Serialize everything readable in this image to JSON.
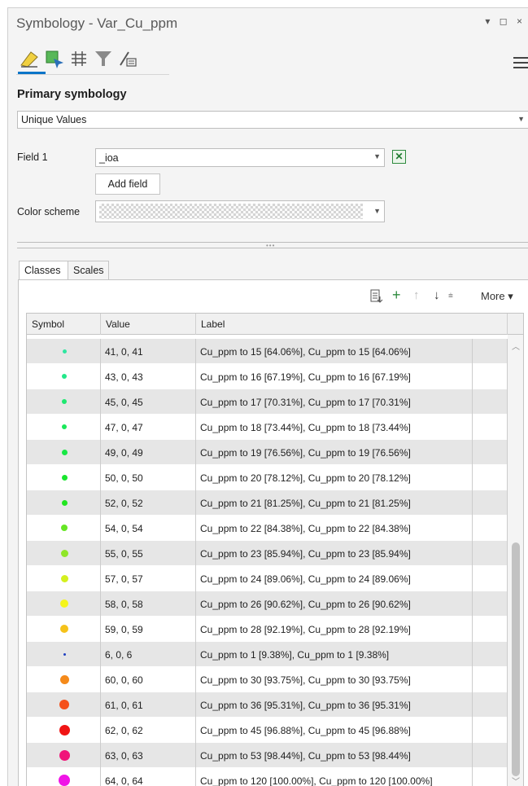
{
  "window": {
    "title": "Symbology - Var_Cu_ppm",
    "controls": "▾ ◻ ×"
  },
  "toolbar": {
    "icons": [
      "primary-symbology-icon",
      "vary-symbology-icon",
      "symbol-layers-icon",
      "filter-icon",
      "display-options-icon"
    ],
    "active_index": 0
  },
  "primary": {
    "section_title": "Primary symbology",
    "method": "Unique Values"
  },
  "form": {
    "field1_label": "Field 1",
    "field1_value": "_ioa",
    "add_field_label": "Add field",
    "color_scheme_label": "Color scheme"
  },
  "tabs": [
    {
      "label": "Classes",
      "active": true
    },
    {
      "label": "Scales",
      "active": false
    }
  ],
  "class_tools": {
    "more_label": "More ▾"
  },
  "grid": {
    "headers": {
      "symbol": "Symbol",
      "value": "Value",
      "label": "Label"
    },
    "rows": [
      {
        "value": "41, 0, 41",
        "label": "Cu_ppm  to 15  [64.06%], Cu_ppm  to 15  [64.06%]",
        "color": "#2ee6a0",
        "size": 5
      },
      {
        "value": "43, 0, 43",
        "label": "Cu_ppm  to 16  [67.19%], Cu_ppm  to 16  [67.19%]",
        "color": "#22e88a",
        "size": 6
      },
      {
        "value": "45, 0, 45",
        "label": "Cu_ppm  to 17  [70.31%], Cu_ppm  to 17  [70.31%]",
        "color": "#1ee870",
        "size": 6
      },
      {
        "value": "47, 0, 47",
        "label": "Cu_ppm  to 18  [73.44%], Cu_ppm  to 18  [73.44%]",
        "color": "#1ae85a",
        "size": 6
      },
      {
        "value": "49, 0, 49",
        "label": "Cu_ppm  to 19  [76.56%], Cu_ppm  to 19  [76.56%]",
        "color": "#18e845",
        "size": 7
      },
      {
        "value": "50, 0, 50",
        "label": "Cu_ppm  to 20  [78.12%], Cu_ppm  to 20  [78.12%]",
        "color": "#19e62e",
        "size": 7
      },
      {
        "value": "52, 0, 52",
        "label": "Cu_ppm  to 21  [81.25%], Cu_ppm  to 21  [81.25%]",
        "color": "#22e620",
        "size": 7
      },
      {
        "value": "54, 0, 54",
        "label": "Cu_ppm  to 22  [84.38%], Cu_ppm  to 22  [84.38%]",
        "color": "#66e624",
        "size": 8
      },
      {
        "value": "55, 0, 55",
        "label": "Cu_ppm  to 23  [85.94%], Cu_ppm  to 23  [85.94%]",
        "color": "#8fe628",
        "size": 9
      },
      {
        "value": "57, 0, 57",
        "label": "Cu_ppm  to 24  [89.06%], Cu_ppm  to 24  [89.06%]",
        "color": "#d4f01e",
        "size": 9
      },
      {
        "value": "58, 0, 58",
        "label": "Cu_ppm  to 26  [90.62%], Cu_ppm  to 26  [90.62%]",
        "color": "#f5f51a",
        "size": 10
      },
      {
        "value": "59, 0, 59",
        "label": "Cu_ppm  to 28  [92.19%], Cu_ppm  to 28  [92.19%]",
        "color": "#f5c21a",
        "size": 10
      },
      {
        "value": "6, 0, 6",
        "label": "Cu_ppm  to 1  [9.38%], Cu_ppm  to 1  [9.38%]",
        "color": "#2040c0",
        "size": 3
      },
      {
        "value": "60, 0, 60",
        "label": "Cu_ppm  to 30  [93.75%], Cu_ppm  to 30  [93.75%]",
        "color": "#f58a1a",
        "size": 11
      },
      {
        "value": "61, 0, 61",
        "label": "Cu_ppm  to 36  [95.31%], Cu_ppm  to 36  [95.31%]",
        "color": "#f5501a",
        "size": 12
      },
      {
        "value": "62, 0, 62",
        "label": "Cu_ppm  to 45  [96.88%], Cu_ppm  to 45  [96.88%]",
        "color": "#f01414",
        "size": 13
      },
      {
        "value": "63, 0, 63",
        "label": "Cu_ppm  to 53  [98.44%], Cu_ppm  to 53  [98.44%]",
        "color": "#f0147a",
        "size": 13
      },
      {
        "value": "64, 0, 64",
        "label": "Cu_ppm  to 120  [100.00%], Cu_ppm  to 120  [100.00%]",
        "color": "#f014e6",
        "size": 14
      }
    ]
  }
}
